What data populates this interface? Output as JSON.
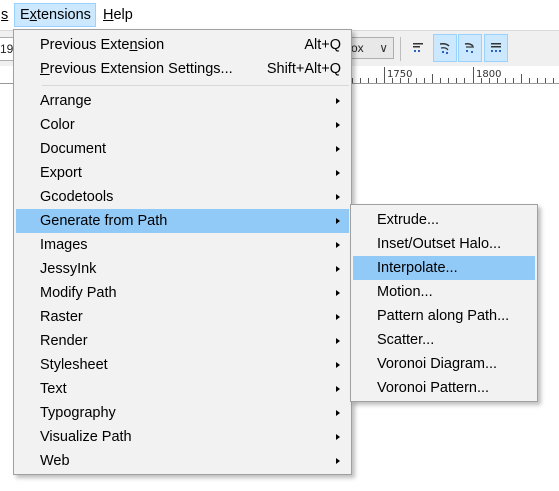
{
  "menubar": {
    "partial_label": "s",
    "extensions_pre": "E",
    "extensions_mnemonic": "x",
    "extensions_post": "tensions",
    "help_mnemonic": "H",
    "help_post": "elp"
  },
  "toolbar": {
    "left_field_value": "19",
    "combo_value": "ox",
    "combo_arrow": "∨"
  },
  "ruler": {
    "label_1": "1750",
    "label_2": "1800"
  },
  "extensions_menu": {
    "previous_extension_pre": "Previous Exte",
    "previous_extension_mnemonic": "n",
    "previous_extension_post": "sion",
    "previous_extension_shortcut": "Alt+Q",
    "previous_settings_mnemonic": "P",
    "previous_settings_post": "revious Extension Settings...",
    "previous_settings_shortcut": "Shift+Alt+Q",
    "items": [
      "Arrange",
      "Color",
      "Document",
      "Export",
      "Gcodetools",
      "Generate from Path",
      "Images",
      "JessyInk",
      "Modify Path",
      "Raster",
      "Render",
      "Stylesheet",
      "Text",
      "Typography",
      "Visualize Path",
      "Web"
    ],
    "highlighted_item": "Generate from Path"
  },
  "generate_from_path_submenu": {
    "items": [
      "Extrude...",
      "Inset/Outset Halo...",
      "Interpolate...",
      "Motion...",
      "Pattern along Path...",
      "Scatter...",
      "Voronoi Diagram...",
      "Voronoi Pattern..."
    ],
    "highlighted_item": "Interpolate..."
  },
  "colors": {
    "menu_bg": "#f2f2f2",
    "highlight": "#91c9f7",
    "menubar_active": "#cce8ff",
    "pressed_button": "#cce8ff"
  },
  "icons": {
    "toolbar_1": "text-align-icon",
    "toolbar_2": "align-curve-icon",
    "toolbar_3": "distribute-curve-icon",
    "toolbar_4": "grid-align-icon"
  }
}
